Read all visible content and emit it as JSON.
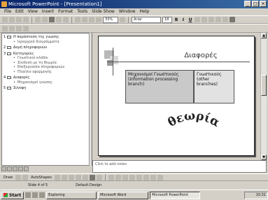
{
  "window": {
    "title": "Microsoft PowerPoint - [Presentation1]"
  },
  "menu": [
    "File",
    "Edit",
    "View",
    "Insert",
    "Format",
    "Tools",
    "Slide Show",
    "Window",
    "Help"
  ],
  "toolbar": {
    "zoom": "33%",
    "font": "Arial",
    "font_size": "18"
  },
  "outline": {
    "items": [
      {
        "num": "1",
        "title": "Η παράσταση της γνώσης",
        "subs": [
          "Ιεραρχικά διαγράμματα"
        ]
      },
      {
        "num": "2",
        "title": "Δομή πληροφοριών",
        "subs": []
      },
      {
        "num": "3",
        "title": "Κατηγορίες",
        "subs": [
          "Γνωστικοί κλάδοι",
          "Σύνδεση με τη θεωρία",
          "Επεξεργασία πληροφοριών",
          "Πλαίσιο εφαρμογής"
        ]
      },
      {
        "num": "4",
        "title": "Διαφορές",
        "subs": [
          "Μηχανισμοί γνώσης"
        ]
      },
      {
        "num": "5",
        "title": "Σύνοψη",
        "subs": []
      }
    ]
  },
  "slide": {
    "title": "Διαφορές",
    "box_left": "Μηχανισμοί Γνωστικούς (information processing branch)",
    "box_right": "Γνωστικούς (other branches)",
    "wordart": "θεωρία"
  },
  "notes": {
    "placeholder": "Click to add notes"
  },
  "drawbar": {
    "draw_label": "Draw",
    "autoshapes_label": "AutoShapes"
  },
  "statusbar": {
    "slide": "Slide 4 of 5",
    "design": "Default Design"
  },
  "taskbar": {
    "start_label": "Start",
    "tasks": [
      "Exploring",
      "Microsoft Word",
      "Microsoft PowerPoint"
    ],
    "clock": "10:31"
  }
}
